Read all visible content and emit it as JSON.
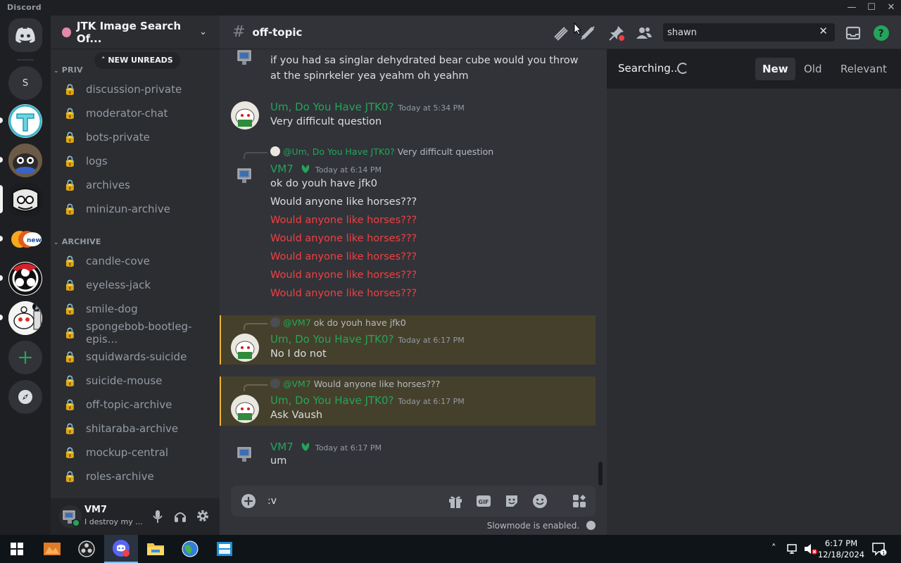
{
  "window": {
    "app_name": "Discord"
  },
  "guild": {
    "name": "JTK Image Search Of..."
  },
  "new_unreads": "NEW UNREADS",
  "categories": [
    {
      "label": "PRIV",
      "channels": [
        "discussion-private",
        "moderator-chat",
        "bots-private",
        "logs",
        "archives",
        "minizun-archive"
      ]
    },
    {
      "label": "ARCHIVE",
      "channels": [
        "candle-cove",
        "eyeless-jack",
        "smile-dog",
        "spongebob-bootleg-epis...",
        "squidwards-suicide",
        "suicide-mouse",
        "off-topic-archive",
        "shitaraba-archive",
        "mockup-central",
        "roles-archive"
      ]
    }
  ],
  "user": {
    "name": "VM7",
    "status": "I destroy my ..."
  },
  "channel": {
    "name": "off-topic"
  },
  "search": {
    "query": "shawn",
    "status": "Searching...",
    "sort_options": [
      "New",
      "Old",
      "Relevant"
    ],
    "active_sort": "New"
  },
  "messages": {
    "top_text": [
      "if you had sa singlar dehydrated bear cube would you throw",
      "at the spinrkeler yea yeahm oh yeahm"
    ],
    "m1": {
      "author": "Um, Do You Have JTK0?",
      "time": "Today at 5:34 PM",
      "text": "Very difficult question"
    },
    "m2": {
      "reply_mention": "@Um, Do You Have JTK0?",
      "reply_text": "Very difficult question",
      "author": "VM7",
      "time": "Today at 6:14 PM",
      "lines": [
        "ok do youh have jfk0",
        "Would anyone like horses???"
      ],
      "failed_lines": [
        "Would anyone like horses???",
        "Would anyone like horses???",
        "Would anyone like horses???",
        "Would anyone like horses???",
        "Would anyone like horses???"
      ]
    },
    "m3": {
      "reply_mention": "@VM7",
      "reply_text": "ok do youh have jfk0",
      "author": "Um, Do You Have JTK0?",
      "time": "Today at 6:17 PM",
      "text": "No I do not"
    },
    "m4": {
      "reply_mention": "@VM7",
      "reply_text": "Would anyone like horses???",
      "author": "Um, Do You Have JTK0?",
      "time": "Today at 6:17 PM",
      "text": "Ask Vaush"
    },
    "m5": {
      "author": "VM7",
      "time": "Today at 6:17 PM",
      "text": "um"
    }
  },
  "composer": {
    "value": ":v",
    "slowmode": "Slowmode is enabled."
  },
  "rail": {
    "dm_letter": "S"
  },
  "taskbar": {
    "time": "6:17 PM",
    "date": "12/18/2024"
  },
  "colors": {
    "author_green": "#23a55a",
    "failed_red": "#f23f43",
    "accent": "#5865f2",
    "highlight": "#f0b232"
  }
}
